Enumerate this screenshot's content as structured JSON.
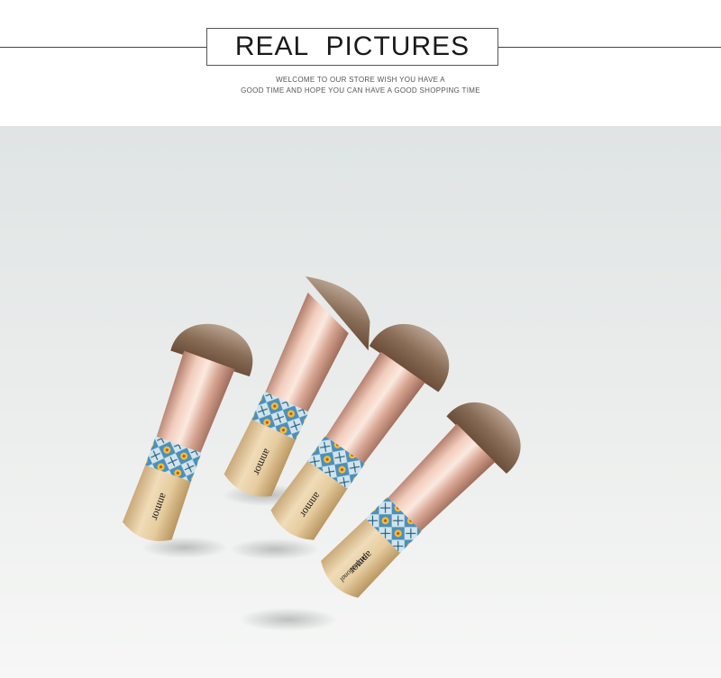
{
  "header": {
    "title": "REAL  PICTURES",
    "subtitle_line1": "WELCOME TO OUR STORE WISH YOU HAVE A",
    "subtitle_line2": "GOOD TIME AND HOPE YOU CAN HAVE A GOOD SHOPPING TIME"
  },
  "photo": {
    "brand_text": "anmor",
    "brand_subtext": "professional",
    "brush_count": 4,
    "colors": {
      "background_top": "#dfe4e4",
      "background_bottom": "#f6f7f6",
      "bristle": "#8a6e58",
      "ferrule": "#d8a693",
      "handle": "#e3c79f",
      "pattern_blue": "#4e8fb8",
      "pattern_yellow": "#f0c03a"
    }
  }
}
